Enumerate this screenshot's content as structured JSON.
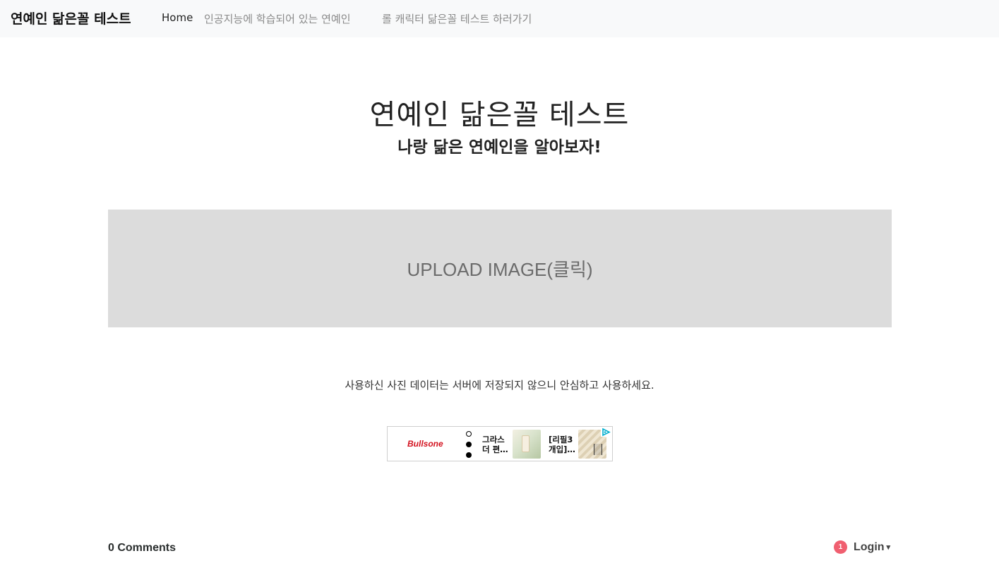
{
  "navbar": {
    "brand": "연예인 닮은꼴 테스트",
    "links": [
      {
        "label": "Home",
        "active": true
      },
      {
        "label": "인공지능에 학습되어 있는 연예인",
        "active": false
      },
      {
        "label": "롤 캐릭터 닮은꼴 테스트 하러가기",
        "active": false
      }
    ]
  },
  "hero": {
    "title": "연예인 닮은꼴 테스트",
    "subtitle": "나랑 닮은 연예인을 알아보자!"
  },
  "upload": {
    "label": "UPLOAD IMAGE(클릭)"
  },
  "notice": "사용하신 사진 데이터는 서버에 저장되지 않으니 안심하고 사용하세요.",
  "ad": {
    "logo": "Bullsone",
    "item1_line1": "그라스",
    "item1_line2": "더 편…",
    "item2_line1": "[리필3",
    "item2_line2": "개입]…",
    "adchoices_icon": "adchoices-icon"
  },
  "comments": {
    "count_label": "0 Comments",
    "notification_count": "1",
    "login_label": "Login",
    "login_caret": "▾"
  },
  "colors": {
    "navbar_bg": "#f8f9fa",
    "upload_bg": "#dcdcdc",
    "badge": "#f05f70",
    "ad_logo": "#d3121f"
  }
}
